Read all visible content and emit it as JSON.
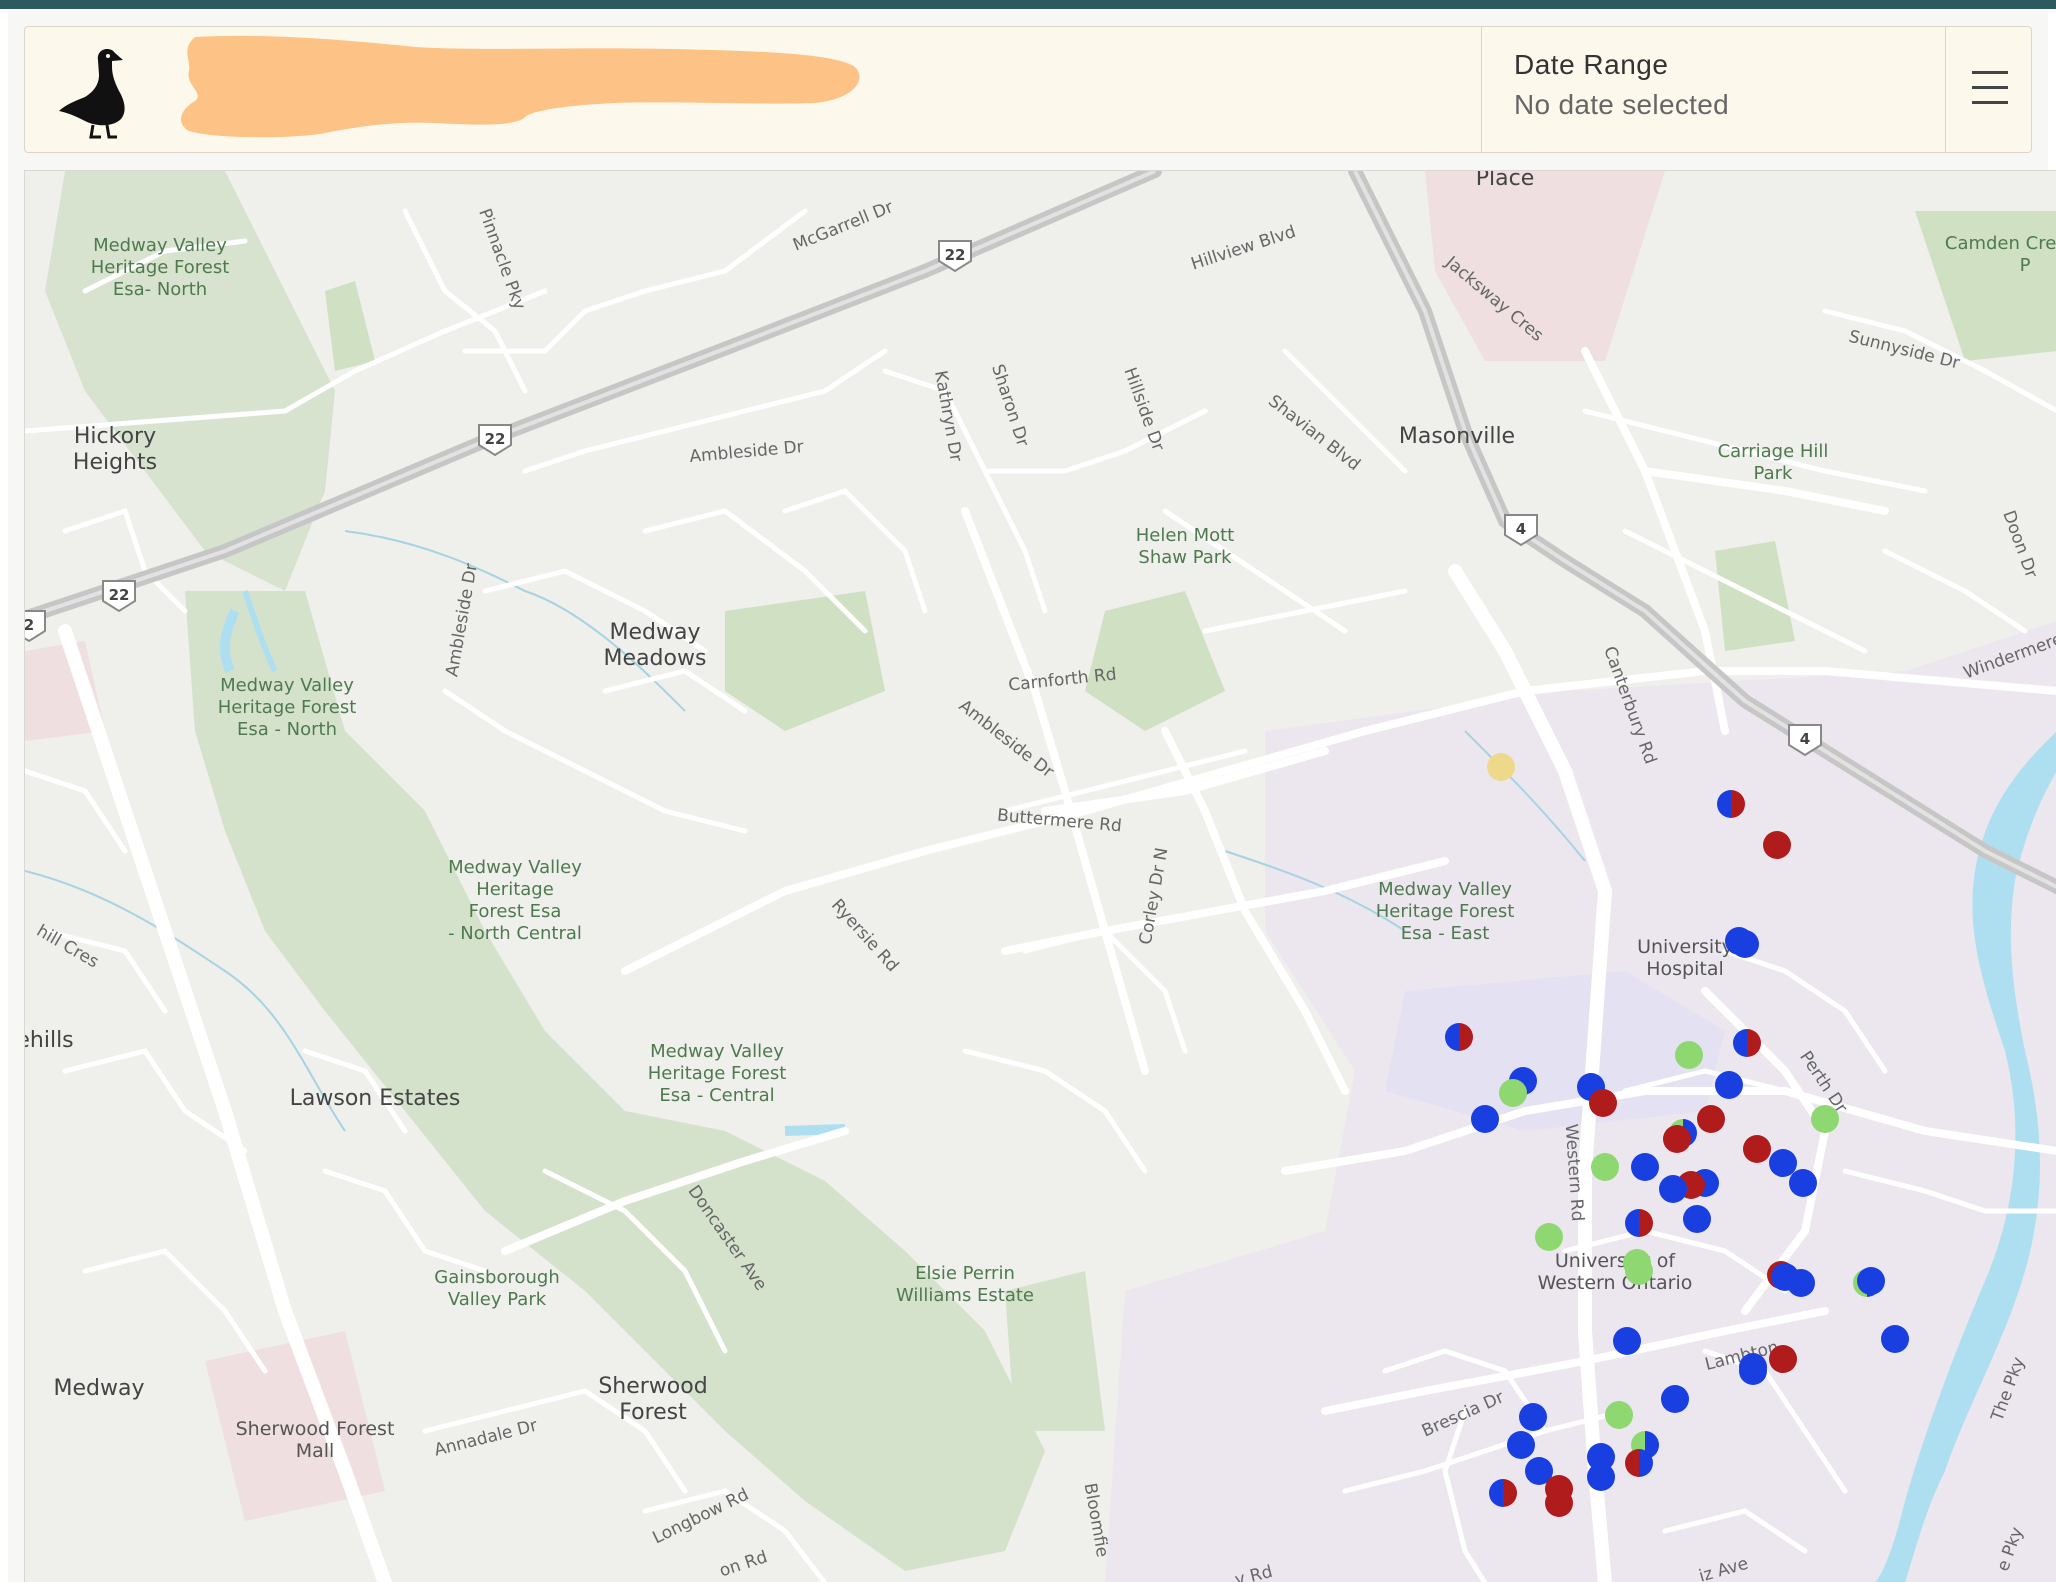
{
  "header": {
    "logo_icon": "goose-icon",
    "date_range_label": "Date Range",
    "date_range_value": "No date selected",
    "menu_icon": "hamburger-menu-icon"
  },
  "map": {
    "place_labels": [
      "Hickory Heights",
      "Medway Meadows",
      "Masonville",
      "Lawson Estates",
      "Medway",
      "Sherwood Forest",
      "Place",
      "ehills"
    ],
    "park_labels": [
      "Medway Valley Heritage Forest Esa- North",
      "Medway Valley Heritage Forest Esa - North",
      "Medway Valley Heritage Forest Esa - North Central",
      "Medway Valley Heritage Forest Esa - Central",
      "Medway Valley Heritage Forest Esa - East",
      "Helen Mott Shaw Park",
      "Carriage Hill Park",
      "Gainsborough Valley Park",
      "Elsie Perrin Williams Estate",
      "Camden Crescent P"
    ],
    "poi_labels": [
      "University Hospital",
      "University of Western Ontario",
      "Sherwood Forest Mall"
    ],
    "road_labels": [
      "McGarrell Dr",
      "Pinnacle Pky",
      "Hillview Blvd",
      "Jacksway Cres",
      "Sunnyside Dr",
      "Ambleside Dr",
      "Kathryn Dr",
      "Sharon Dr",
      "Hillside Dr",
      "Shavian Blvd",
      "Doon Dr",
      "Ambleside Dr",
      "Carnforth Rd",
      "Canterbury Rd",
      "Windermere",
      "Ambleside Dr",
      "Buttermere Rd",
      "Corley Dr N",
      "Ryersie Rd",
      "hill Cres",
      "Western Rd",
      "Perth Dr",
      "Doncaster Ave",
      "Lambton",
      "Brescia Dr",
      "Annadale Dr",
      "Longbow Rd",
      "Bloomfie",
      "The Pky",
      "on Rd",
      "y Rd",
      "iz Ave",
      "e Pky"
    ],
    "highway_shields": [
      "22",
      "22",
      "22",
      "2",
      "4",
      "4"
    ],
    "marker_colors": {
      "blue": "#1a3fe0",
      "red": "#b01b1b",
      "green": "#8fd770",
      "yellow": "#eed98a"
    }
  }
}
